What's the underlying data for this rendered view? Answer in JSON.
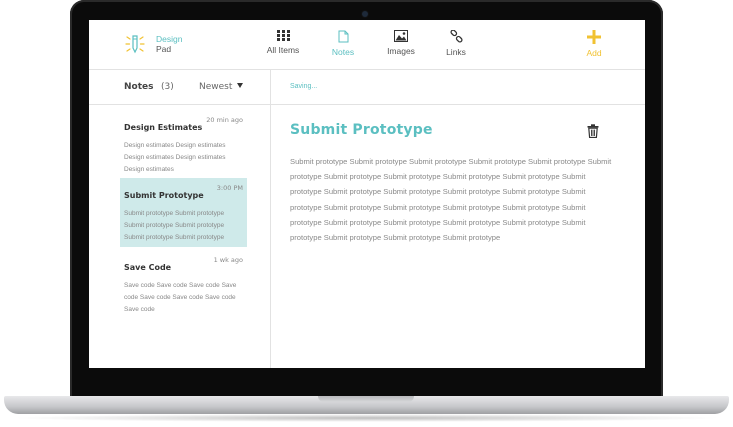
{
  "app": {
    "logo_line1": "Design",
    "logo_line2": "Pad"
  },
  "nav": {
    "all_items": "All Items",
    "notes": "Notes",
    "images": "Images",
    "links": "Links",
    "add": "Add",
    "active": "notes"
  },
  "sidebar": {
    "title": "Notes",
    "count": "(3)",
    "sort": "Newest"
  },
  "notes": [
    {
      "title": "Design Estimates",
      "time": "20 min ago",
      "preview": "Design estimates Design estimates Design estimates Design estimates Design estimates",
      "selected": false
    },
    {
      "title": "Submit Prototype",
      "time": "3:00 PM",
      "preview": "Submit prototype Submit prototype Submit prototype Submit prototype Submit prototype Submit prototype",
      "selected": true
    },
    {
      "title": "Save Code",
      "time": "1 wk ago",
      "preview": "Save code Save code Save code Save code Save code Save code Save code Save code",
      "selected": false
    }
  ],
  "editor": {
    "status": "Saving...",
    "title": "Submit Prototype",
    "body": "Submit prototype Submit prototype Submit prototype Submit prototype Submit prototype Submit prototype Submit prototype Submit prototype Submit prototype Submit prototype Submit prototype Submit prototype Submit prototype Submit prototype Submit prototype Submit prototype Submit prototype Submit prototype Submit prototype Submit prototype Submit prototype Submit prototype Submit prototype Submit prototype Submit prototype Submit prototype Submit prototype Submit prototype Submit prototype"
  },
  "colors": {
    "accent": "#5bbfc1",
    "add": "#f1c232",
    "selected_bg": "#cfeaea"
  },
  "icons": {
    "logo": "pencil-logo-icon",
    "all_items": "grid-icon",
    "notes": "document-icon",
    "images": "image-icon",
    "links": "link-icon",
    "add": "plus-icon",
    "trash": "trash-icon",
    "sort": "caret-down-icon"
  }
}
